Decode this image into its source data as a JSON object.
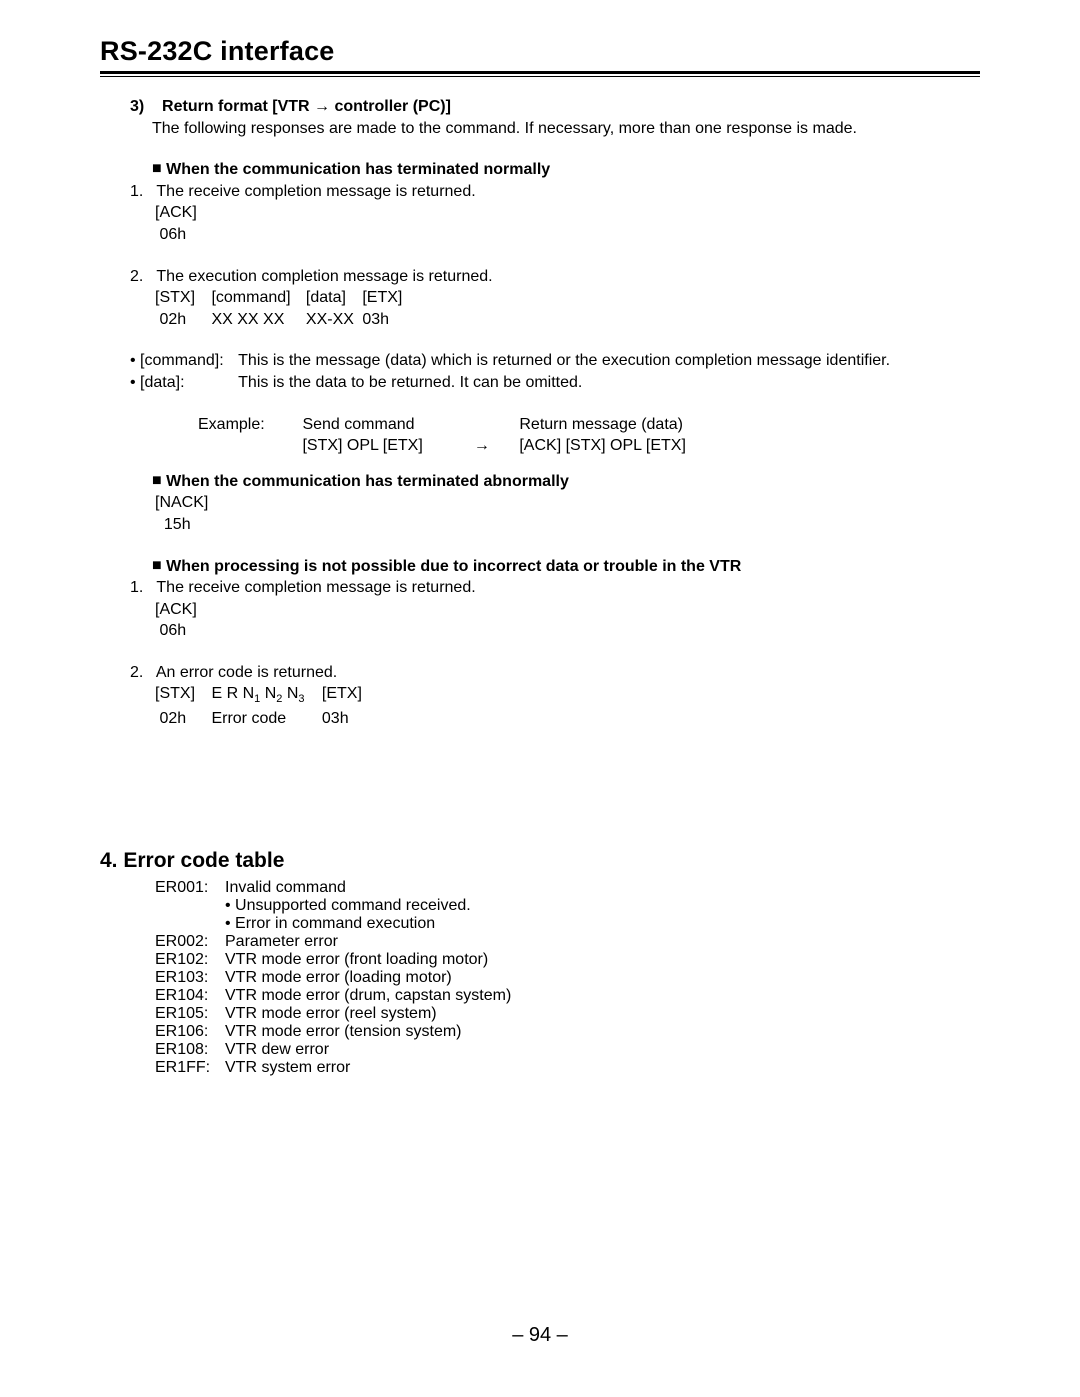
{
  "title": "RS-232C interface",
  "s3": {
    "num": "3)",
    "heading": "Return format [VTR → controller (PC)]",
    "intro": "The following responses are made to the command. If necessary, more than one response is made.",
    "h_norm": "When the communication has terminated normally",
    "n1_num": "1.",
    "n1_txt": "The receive completion message is returned.",
    "ack": "[ACK]",
    "ack_hex": " 06h",
    "n2_num": "2.",
    "n2_txt": "The execution completion message is returned.",
    "stx_lbl": "[STX]",
    "cmd_lbl": "[command]",
    "data_lbl": "[data]",
    "etx_lbl": "[ETX]",
    "hex02": " 02h",
    "hexXX": "XX XX XX",
    "hexXXs": "XX-XX",
    "hex03": "03h",
    "cmd_desc_k": "• [command]:",
    "cmd_desc_v": "This is the message (data) which is returned or the execution completion message identifier.",
    "data_desc_k": "• [data]:",
    "data_desc_v": "This is the data to be returned. It can be omitted.",
    "ex_lbl": "Example:",
    "ex_send_h": "Send command",
    "ex_send_v": "[STX] OPL [ETX]",
    "ex_arrow": "→",
    "ex_ret_h": "Return message (data)",
    "ex_ret_v": "[ACK] [STX] OPL [ETX]",
    "h_abn": "When the communication has terminated abnormally",
    "nack": "[NACK]",
    "nack_hex": "  15h",
    "h_trb": "When processing is not possible due to incorrect data or trouble in the VTR",
    "t1_num": "1.",
    "t1_txt": "The receive completion message is returned.",
    "t_ack": "[ACK]",
    "t_ack_hex": " 06h",
    "t2_num": "2.",
    "t2_txt": "An error code is returned.",
    "t2_stx": "[STX]",
    "t2_er": "E R N",
    "t2_n1": "1",
    "t2_nmid": " N",
    "t2_n2": "2",
    "t2_nmid2": " N",
    "t2_n3": "3",
    "t2_etx": "[ETX]",
    "t2_hex02": " 02h",
    "t2_ec": "Error code",
    "t2_hex03": "03h"
  },
  "ec": {
    "heading": "4. Error code table",
    "items": [
      {
        "code": "ER001:",
        "desc": "Invalid command",
        "sub": [
          "• Unsupported command received.",
          "• Error in command execution"
        ]
      },
      {
        "code": "ER002:",
        "desc": "Parameter error"
      },
      {
        "code": "ER102:",
        "desc": "VTR mode error (front loading motor)"
      },
      {
        "code": "ER103:",
        "desc": "VTR mode error (loading motor)"
      },
      {
        "code": "ER104:",
        "desc": "VTR mode error (drum, capstan system)"
      },
      {
        "code": "ER105:",
        "desc": "VTR mode error (reel system)"
      },
      {
        "code": "ER106:",
        "desc": "VTR mode error (tension system)"
      },
      {
        "code": "ER108:",
        "desc": "VTR dew error"
      },
      {
        "code": "ER1FF:",
        "desc": "VTR system error"
      }
    ]
  },
  "page_number": "– 94 –"
}
